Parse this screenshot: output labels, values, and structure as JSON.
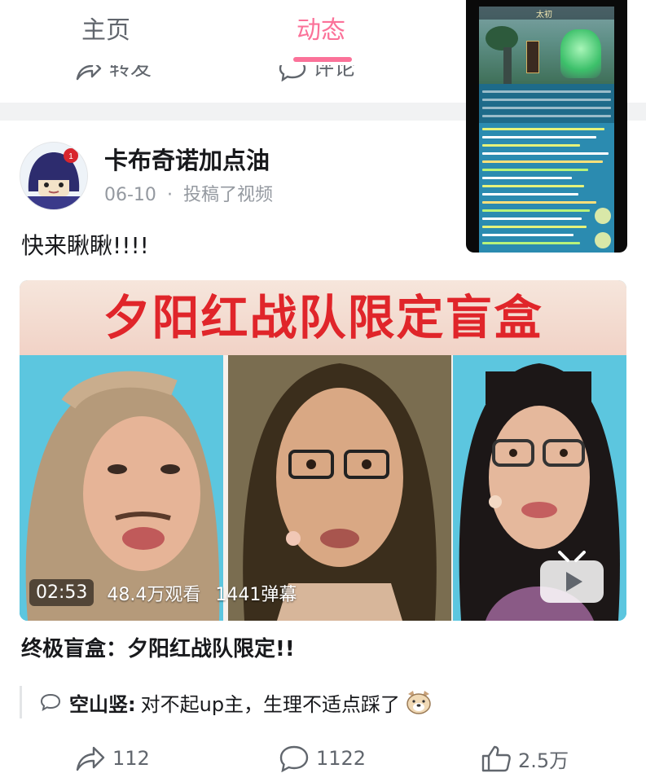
{
  "tabs": {
    "home_label": "主页",
    "dynamic_label": "动态",
    "active_color": "#fb7299"
  },
  "previous_card": {
    "forward_label": "转发",
    "comment_label": "评论"
  },
  "mini_player": {
    "title": "太初"
  },
  "post": {
    "author": "卡布奇诺加点油",
    "date": "06-10",
    "separator": "·",
    "action": "投稿了视频",
    "text": "快来瞅瞅!!!!",
    "video": {
      "headline": "夕阳红战队限定盲盒",
      "duration": "02:53",
      "views": "48.4万观看",
      "danmaku": "1441弹幕",
      "title": "终极盲盒：夕阳红战队限定!!"
    },
    "hot_comment": {
      "user": "空山竖:",
      "text": "对不起up主，生理不适点踩了"
    },
    "actions": {
      "forward_count": "112",
      "comment_count": "1122",
      "like_count": "2.5万"
    }
  }
}
